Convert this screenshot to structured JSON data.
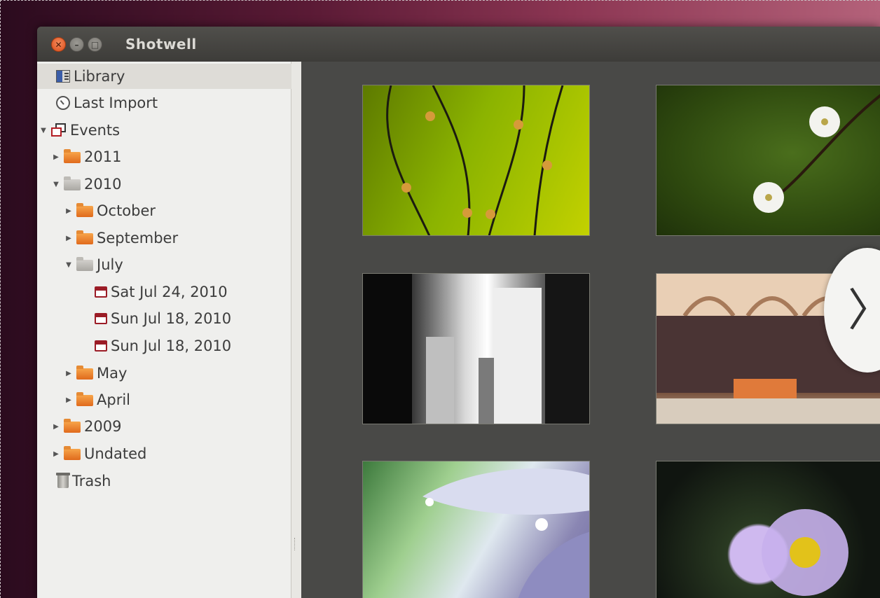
{
  "window": {
    "title": "Shotwell",
    "close_glyph": "✕",
    "min_glyph": "–",
    "max_glyph": "□"
  },
  "sidebar": {
    "library": "Library",
    "last_import": "Last Import",
    "events": "Events",
    "year_2011": "2011",
    "year_2010": "2010",
    "october": "October",
    "september": "September",
    "july": "July",
    "event_1": "Sat Jul 24, 2010",
    "event_2": "Sun Jul 18, 2010",
    "event_3": "Sun Jul 18, 2010",
    "may": "May",
    "april": "April",
    "year_2009": "2009",
    "undated": "Undated",
    "trash": "Trash"
  },
  "expander": {
    "collapsed": "▶",
    "expanded": "▼"
  },
  "next_glyph": "〉",
  "colors": {
    "accent_close": "#e0581f",
    "background_content": "#494947",
    "sidebar": "#efefed"
  },
  "icons": [
    "library-icon",
    "last-import-icon",
    "events-icon",
    "folder-icon",
    "event-icon",
    "trash-icon",
    "chevron-right-icon"
  ]
}
